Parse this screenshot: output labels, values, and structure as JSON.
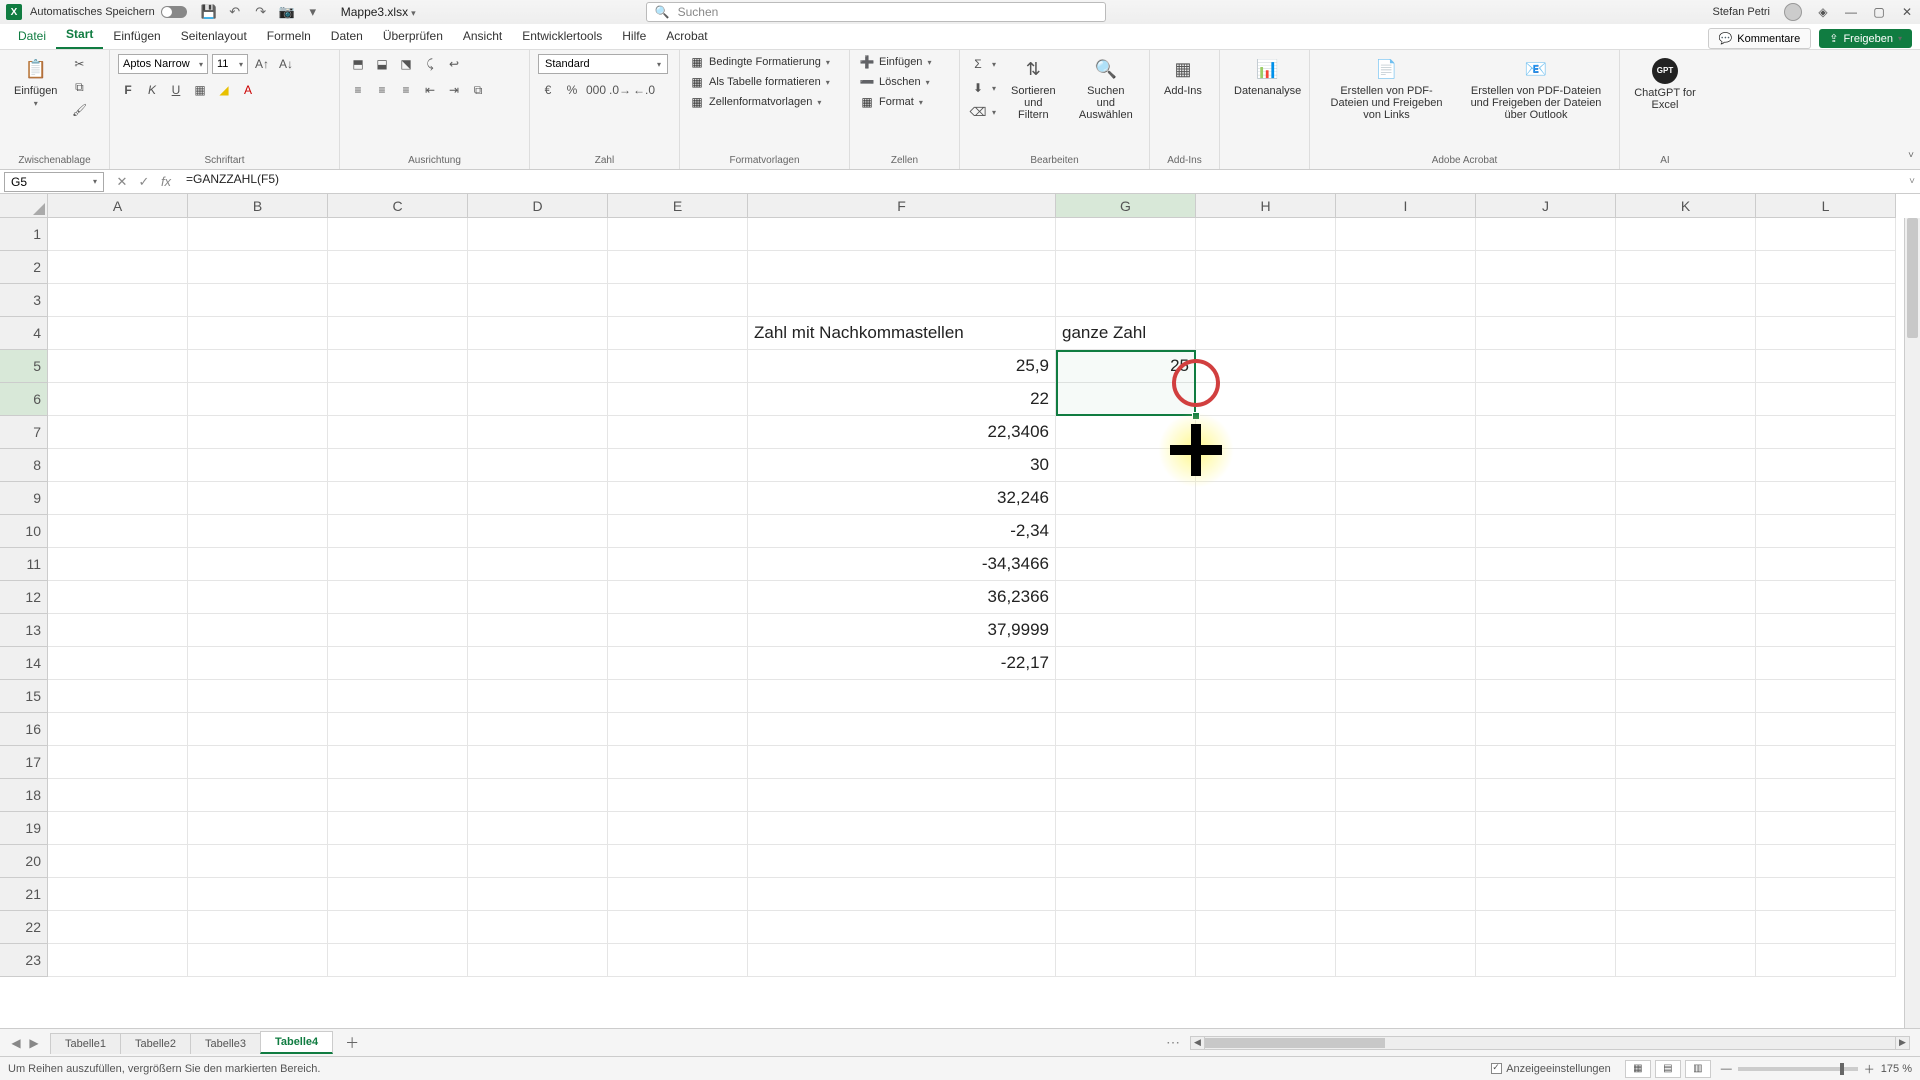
{
  "title": {
    "autosave_label": "Automatisches Speichern",
    "filename": "Mappe3.xlsx",
    "search_placeholder": "Suchen",
    "user_name": "Stefan Petri"
  },
  "tabs": {
    "file": "Datei",
    "start": "Start",
    "insert": "Einfügen",
    "pagelayout": "Seitenlayout",
    "formulas": "Formeln",
    "data": "Daten",
    "review": "Überprüfen",
    "view": "Ansicht",
    "dev": "Entwicklertools",
    "help": "Hilfe",
    "acrobat": "Acrobat",
    "comments": "Kommentare",
    "share": "Freigeben"
  },
  "ribbon": {
    "clipboard": {
      "paste": "Einfügen",
      "label": "Zwischenablage"
    },
    "font": {
      "name": "Aptos Narrow",
      "size": "11",
      "label": "Schriftart"
    },
    "align": {
      "label": "Ausrichtung"
    },
    "number": {
      "format": "Standard",
      "label": "Zahl"
    },
    "styles": {
      "cond": "Bedingte Formatierung",
      "table": "Als Tabelle formatieren",
      "cellstyles": "Zellenformatvorlagen",
      "label": "Formatvorlagen"
    },
    "cells": {
      "insert": "Einfügen",
      "delete": "Löschen",
      "format": "Format",
      "label": "Zellen"
    },
    "editing": {
      "sort": "Sortieren und Filtern",
      "find": "Suchen und Auswählen",
      "label": "Bearbeiten"
    },
    "addins": {
      "btn": "Add-Ins",
      "label": "Add-Ins"
    },
    "analysis": {
      "btn": "Datenanalyse"
    },
    "acrobat": {
      "a": "Erstellen von PDF-Dateien und Freigeben von Links",
      "b": "Erstellen von PDF-Dateien und Freigeben der Dateien über Outlook",
      "label": "Adobe Acrobat"
    },
    "ai": {
      "btn": "ChatGPT for Excel",
      "label": "AI"
    }
  },
  "fbar": {
    "cellref": "G5",
    "formula": "=GANZZAHL(F5)"
  },
  "columns": [
    "A",
    "B",
    "C",
    "D",
    "E",
    "F",
    "G",
    "H",
    "I",
    "J",
    "K",
    "L"
  ],
  "rows": [
    "1",
    "2",
    "3",
    "4",
    "5",
    "6",
    "7",
    "8",
    "9",
    "10",
    "11",
    "12",
    "13",
    "14",
    "15",
    "16",
    "17",
    "18",
    "19",
    "20",
    "21",
    "22",
    "23"
  ],
  "cells": {
    "F4": "Zahl mit Nachkommastellen",
    "G4": "ganze Zahl",
    "F5": "25,9",
    "G5": "25",
    "F6": "22",
    "F7": "22,3406",
    "F8": "30",
    "F9": "32,246",
    "F10": "-2,34",
    "F11": "-34,3466",
    "F12": "36,2366",
    "F13": "37,9999",
    "F14": "-22,17"
  },
  "sheets": {
    "tabs": [
      "Tabelle1",
      "Tabelle2",
      "Tabelle3",
      "Tabelle4"
    ],
    "active": "Tabelle4"
  },
  "status": {
    "msg": "Um Reihen auszufüllen, vergrößern Sie den markierten Bereich.",
    "display": "Anzeigeeinstellungen",
    "zoom": "175 %"
  }
}
